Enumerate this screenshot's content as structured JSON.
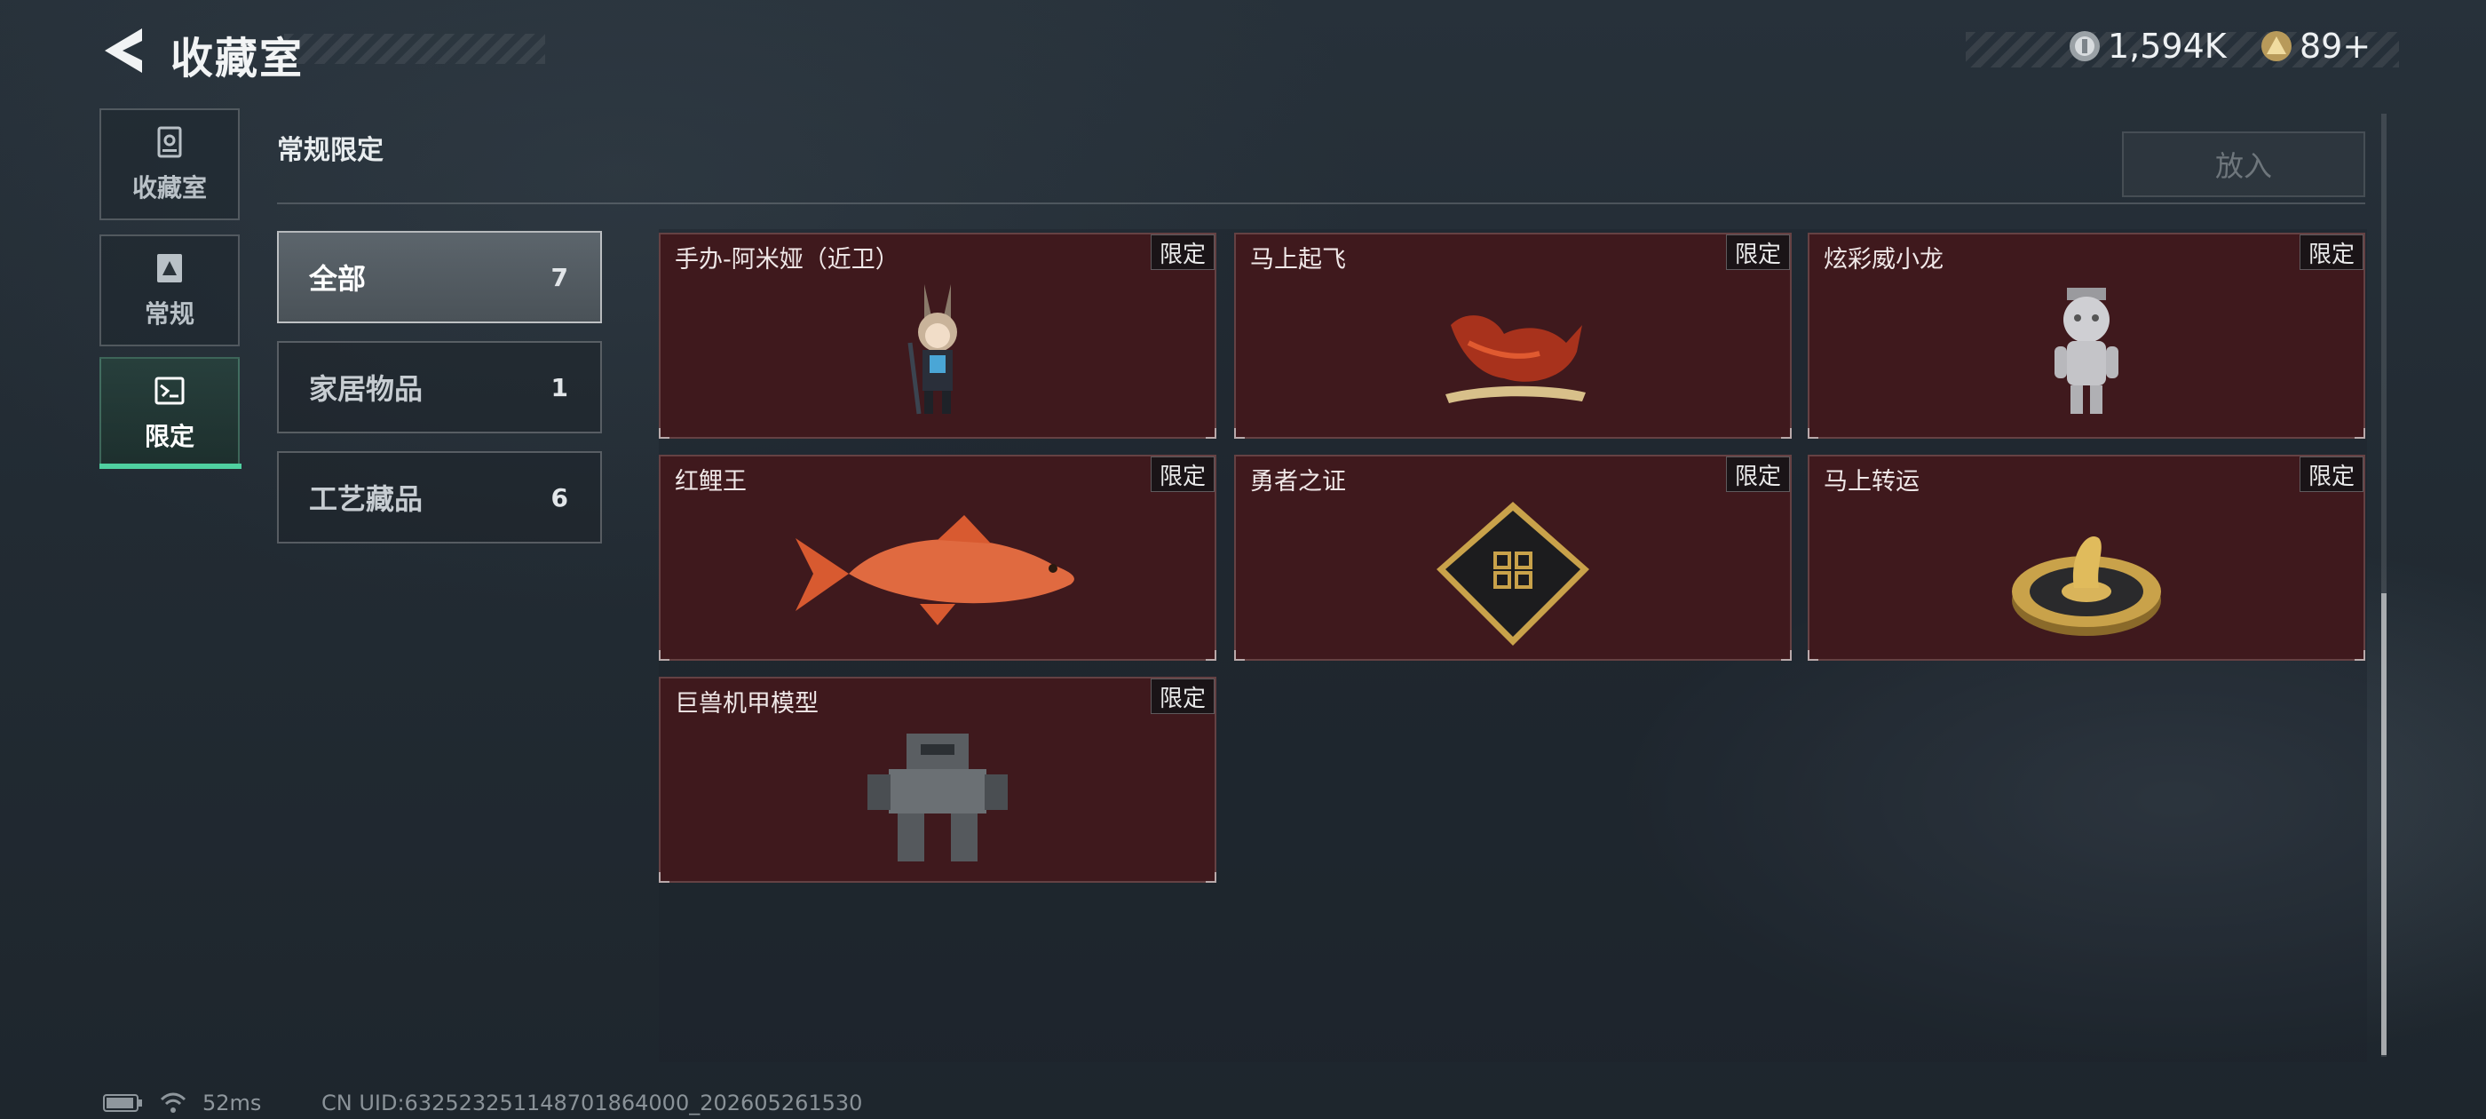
{
  "header": {
    "title": "收藏室",
    "currency": [
      {
        "icon": "silver-coin-icon",
        "value": "1,594K"
      },
      {
        "icon": "gold-coin-icon",
        "value": "89+"
      }
    ]
  },
  "sidebar": {
    "items": [
      {
        "label": "收藏室",
        "icon": "collection-room-icon"
      },
      {
        "label": "常规",
        "icon": "regular-icon"
      },
      {
        "label": "限定",
        "icon": "limited-icon",
        "active": true
      }
    ]
  },
  "section": {
    "title": "常规限定",
    "put_in_label": "放入"
  },
  "categories": [
    {
      "label": "全部",
      "count": "7"
    },
    {
      "label": "家居物品",
      "count": "1"
    },
    {
      "label": "工艺藏品",
      "count": "6"
    }
  ],
  "items": [
    {
      "name": "手办-阿米娅（近卫）",
      "badge": "限定",
      "icon": "figure-amiya-icon"
    },
    {
      "name": "马上起飞",
      "badge": "限定",
      "icon": "red-horse-icon"
    },
    {
      "name": "炫彩威小龙",
      "badge": "限定",
      "icon": "silver-dragon-figure-icon"
    },
    {
      "name": "红鲤王",
      "badge": "限定",
      "icon": "red-carp-icon"
    },
    {
      "name": "勇者之证",
      "badge": "限定",
      "icon": "hero-card-icon"
    },
    {
      "name": "马上转运",
      "badge": "限定",
      "icon": "fortune-wheel-icon"
    },
    {
      "name": "巨兽机甲模型",
      "badge": "限定",
      "icon": "mech-model-icon"
    }
  ],
  "status": {
    "ping": "52ms",
    "uid": "CN UID:632523251148701864000_202605261530"
  },
  "colors": {
    "accent": "#4fd0a0",
    "card_bg": "#3f191d"
  }
}
